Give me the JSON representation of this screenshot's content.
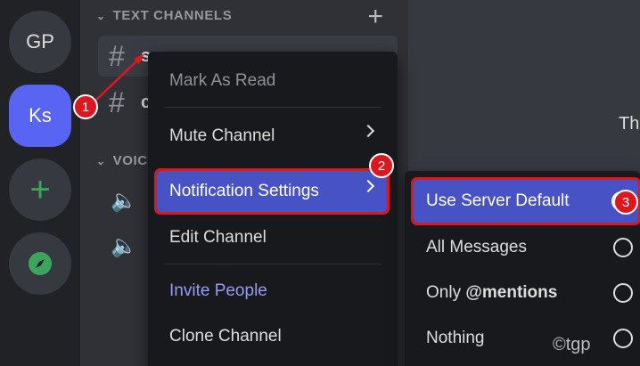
{
  "servers": [
    {
      "label": "GP"
    },
    {
      "label": "Ks"
    }
  ],
  "sidebar": {
    "text_category": "TEXT CHANNELS",
    "voice_category": "VOICE",
    "channels": [
      {
        "name": "s"
      },
      {
        "name": "c"
      }
    ]
  },
  "main": {
    "partial_text": "Th"
  },
  "context_menu": {
    "items": [
      {
        "label": "Mark As Read"
      },
      {
        "label": "Mute Channel"
      },
      {
        "label": "Notification Settings"
      },
      {
        "label": "Edit Channel"
      },
      {
        "label": "Invite People"
      },
      {
        "label": "Clone Channel"
      }
    ]
  },
  "submenu": {
    "items": [
      {
        "label": "Use Server Default",
        "selected": true
      },
      {
        "label": "All Messages",
        "selected": false
      },
      {
        "label_prefix": "Only ",
        "label_bold": "@mentions",
        "selected": false
      },
      {
        "label": "Nothing",
        "selected": false
      }
    ]
  },
  "annotations": {
    "step1": "1",
    "step2": "2",
    "step3": "3"
  },
  "watermark": "©tgp",
  "colors": {
    "accent": "#5865f2",
    "highlight": "#4752c4",
    "annotation": "#e0161e"
  }
}
